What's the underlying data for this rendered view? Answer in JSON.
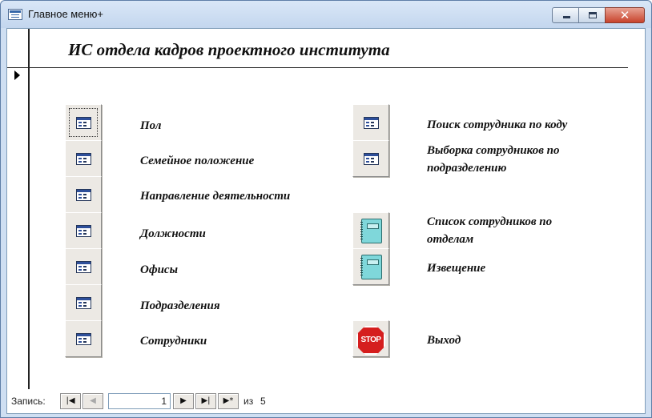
{
  "window": {
    "title": "Главное меню+",
    "close_glyph": "✕"
  },
  "form": {
    "title": "ИС отдела кадров проектного института"
  },
  "left_menu": [
    {
      "label": "Пол",
      "icon": "form-icon"
    },
    {
      "label": "Семейное положение",
      "icon": "form-icon"
    },
    {
      "label": "Направление деятельности",
      "icon": "form-icon"
    },
    {
      "label": "Должности",
      "icon": "form-icon"
    },
    {
      "label": "Офисы",
      "icon": "form-icon"
    },
    {
      "label": "Подразделения",
      "icon": "form-icon"
    },
    {
      "label": "Сотрудники",
      "icon": "form-icon"
    }
  ],
  "right_menu": [
    {
      "label": "Поиск сотрудника по коду",
      "icon": "form-icon"
    },
    {
      "label": "Выборка сотрудников по подразделению",
      "icon": "form-icon"
    },
    {
      "label": "Список сотрудников по отделам",
      "icon": "report-icon"
    },
    {
      "label": "Извещение",
      "icon": "report-icon"
    },
    {
      "label": "Выход",
      "icon": "stop-icon",
      "icon_text": "STOP"
    }
  ],
  "navigation": {
    "record_label": "Запись:",
    "first_glyph": "|◀",
    "prev_glyph": "◀",
    "current_record": "1",
    "next_glyph": "▶",
    "last_glyph": "▶|",
    "new_glyph": "▶*",
    "of_label": "из",
    "total_records": "5"
  }
}
